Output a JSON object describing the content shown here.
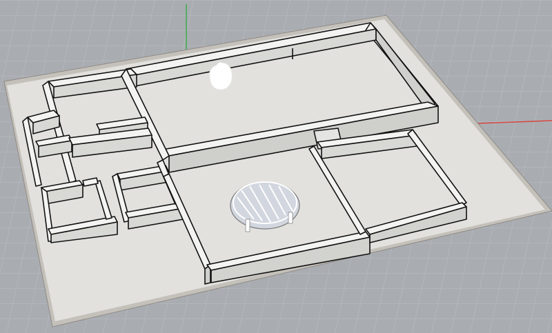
{
  "viewport": {
    "type": "perspective-3d-viewport",
    "background_color": "#a9adb2",
    "grid_color": "#bfc3c8",
    "axis_colors": {
      "x_axis": "#d9443c",
      "y_axis": "#3ea84a"
    },
    "grid_visible": true
  },
  "model": {
    "description_visible": false,
    "ground_plate_color": "#c7c2bb",
    "floor_color": "#e4e3e0",
    "wall_top_color": "#f4f4f2",
    "wall_face_color": "#d6d6d3",
    "wall_outline_color": "#111111",
    "objects": [
      {
        "name": "floor-plan-model",
        "kind": "walls-extruded"
      },
      {
        "name": "pendant-light",
        "kind": "light-fixture"
      },
      {
        "name": "round-table",
        "kind": "furniture"
      }
    ]
  }
}
